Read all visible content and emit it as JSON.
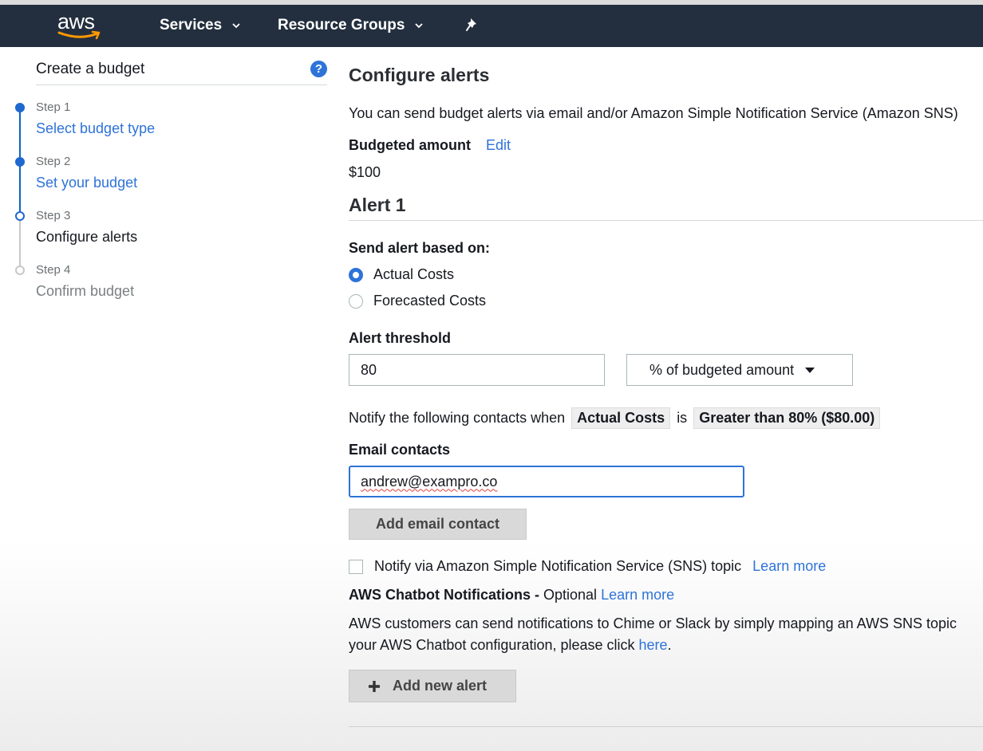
{
  "navbar": {
    "logo_text": "aws",
    "services_label": "Services",
    "resource_groups_label": "Resource Groups"
  },
  "sidebar": {
    "title": "Create a budget",
    "help_glyph": "?",
    "steps": [
      {
        "number": "Step 1",
        "label": "Select budget type",
        "state": "complete"
      },
      {
        "number": "Step 2",
        "label": "Set your budget",
        "state": "complete"
      },
      {
        "number": "Step 3",
        "label": "Configure alerts",
        "state": "current"
      },
      {
        "number": "Step 4",
        "label": "Confirm budget",
        "state": "upcoming"
      }
    ]
  },
  "main": {
    "title": "Configure alerts",
    "intro": "You can send budget alerts via email and/or Amazon Simple Notification Service (Amazon SNS)",
    "budgeted_amount_label": "Budgeted amount",
    "edit_label": "Edit",
    "budgeted_amount_value": "$100",
    "alert_title": "Alert 1",
    "send_alert_label": "Send alert based on:",
    "radio_actual": "Actual Costs",
    "radio_forecasted": "Forecasted Costs",
    "selected_basis": "Actual Costs",
    "threshold_label": "Alert threshold",
    "threshold_value": "80",
    "threshold_unit": "% of budgeted amount",
    "notify_prefix": "Notify the following contacts when",
    "notify_chip_basis": "Actual Costs",
    "notify_is": "is",
    "notify_chip_condition": "Greater than 80% ($80.00)",
    "email_label": "Email contacts",
    "email_value": "andrew@exampro.co",
    "add_email_button": "Add email contact",
    "sns_label": "Notify via Amazon Simple Notification Service (SNS) topic",
    "sns_learn_more": "Learn more",
    "chatbot_title": "AWS Chatbot Notifications -",
    "chatbot_optional": "Optional",
    "chatbot_learn_more": "Learn more",
    "chatbot_desc_line1": "AWS customers can send notifications to Chime or Slack by simply mapping an AWS SNS topic",
    "chatbot_desc_line2_prefix": "your AWS Chatbot configuration, please click",
    "chatbot_here": "here",
    "chatbot_period": ".",
    "add_alert_button": "Add new alert"
  },
  "colors": {
    "navbar_bg": "#232f3e",
    "link": "#2e73d8",
    "logo_smile": "#ff9900"
  }
}
